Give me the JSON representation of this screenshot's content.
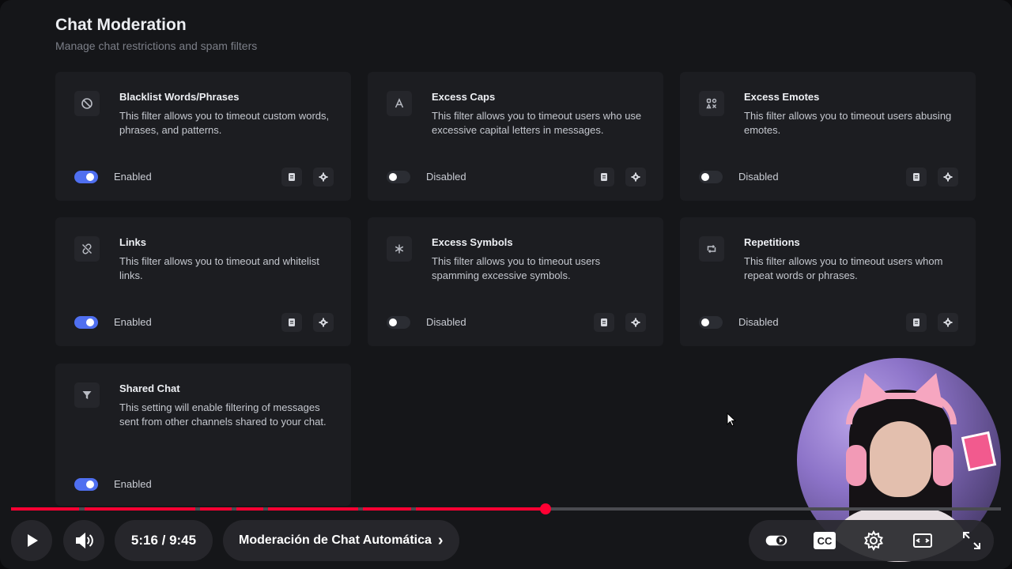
{
  "page": {
    "title": "Chat Moderation",
    "subtitle": "Manage chat restrictions and spam filters"
  },
  "cards": [
    {
      "icon": "block-icon",
      "title": "Blacklist Words/Phrases",
      "description": "This filter allows you to timeout custom words, phrases, and patterns.",
      "status": "Enabled",
      "enabled": true
    },
    {
      "icon": "caps-icon",
      "title": "Excess Caps",
      "description": "This filter allows you to timeout users who use excessive capital letters in messages.",
      "status": "Disabled",
      "enabled": false
    },
    {
      "icon": "emotes-icon",
      "title": "Excess Emotes",
      "description": "This filter allows you to timeout users abusing emotes.",
      "status": "Disabled",
      "enabled": false
    },
    {
      "icon": "unlink-icon",
      "title": "Links",
      "description": "This filter allows you to timeout and whitelist links.",
      "status": "Enabled",
      "enabled": true
    },
    {
      "icon": "asterisk-icon",
      "title": "Excess Symbols",
      "description": "This filter allows you to timeout users spamming excessive symbols.",
      "status": "Disabled",
      "enabled": false
    },
    {
      "icon": "repeat-icon",
      "title": "Repetitions",
      "description": "This filter allows you to timeout users whom repeat words or phrases.",
      "status": "Disabled",
      "enabled": false
    },
    {
      "icon": "filter-icon",
      "title": "Shared Chat",
      "description": "This setting will enable filtering of messages sent from other channels shared to your chat.",
      "status": "Enabled",
      "enabled": true
    }
  ],
  "player": {
    "time": "5:16 / 9:45",
    "chapter": "Moderación de Chat Automática",
    "chapter_arrow": "›",
    "cc_label": "CC",
    "progress_fraction": 0.54,
    "accent_color": "#ff0033",
    "toggle_color": "#4f6ff0"
  }
}
